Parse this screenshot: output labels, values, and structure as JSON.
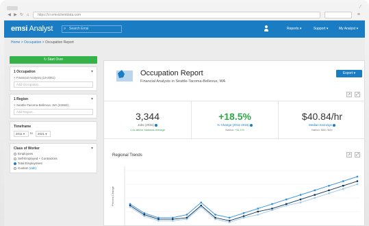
{
  "browser": {
    "url": "https://cr.emsiclientdata.com"
  },
  "app": {
    "logo_bold": "emsi",
    "logo_thin": " Analyst",
    "search_placeholder": "Search Emsi",
    "nav": [
      "Reports ▾",
      "Support ▾",
      "My Analyst ▾"
    ],
    "accent": "#1a7dc4"
  },
  "breadcrumb": {
    "home": "Home",
    "sep": " > ",
    "occupation": "Occupation",
    "current": "Occupation Report"
  },
  "sidebar": {
    "start_button": "↻ Start Over",
    "occupation": {
      "title": "1 Occupation",
      "value": "× Financial Analysts (13-2051)",
      "placeholder": "Add Occupation..."
    },
    "region": {
      "title": "1 Region",
      "value": "× Seattle-Tacoma-Bellevue, WA (42660)",
      "placeholder": "Add Region..."
    },
    "timeframe": {
      "title": "Timeframe",
      "from": "2011 ▾",
      "to_label": "to",
      "to": "2021 ▾"
    },
    "class_of_worker": {
      "title": "Class of Worker",
      "options": [
        "Employees",
        "Self-Employed + Contractors",
        "Total Employment",
        "Custom"
      ],
      "edit": "(edit)"
    }
  },
  "report": {
    "title": "Occupation Report",
    "subtitle": "Financial Analysts in Seattle-Tacoma-Bellevue, WA",
    "export": "Export ▾",
    "kpis": [
      {
        "value": "3,344",
        "label": "Jobs (2016)",
        "foot_a": "1.4x above National average",
        "foot_b": ""
      },
      {
        "value": "+18.5%",
        "label": "% Change (2011-2016)",
        "foot_a": "Nation: ",
        "foot_b": "+11.1%"
      },
      {
        "value": "$40.84/hr",
        "label": "Median Earnings",
        "foot_a": "Nation: $38.78/hr",
        "foot_b": ""
      }
    ],
    "chart_title": "Regional Trends",
    "ylabel": "Percent Change"
  },
  "chart_data": {
    "type": "line",
    "ylabel": "Percent Change",
    "series": [
      {
        "name": "",
        "color": "#2b8ee0",
        "values": [
          0,
          -6,
          -9,
          -9,
          -7,
          1,
          -7,
          -9,
          -6,
          -3,
          0,
          3,
          6,
          9,
          12,
          15,
          18
        ]
      },
      {
        "name": "",
        "color": "#0d2f55",
        "values": [
          -1,
          -7,
          -10,
          -10,
          -9,
          -1,
          -9,
          -11,
          -8,
          -5,
          -3,
          0,
          3,
          6,
          9,
          12,
          15
        ]
      },
      {
        "name": "",
        "color": "#9bc7ec",
        "values": [
          -2,
          -8,
          -11,
          -11,
          -10,
          -2,
          -10,
          -12,
          -9,
          -7,
          -4,
          -1,
          1,
          4,
          7,
          10,
          13
        ]
      }
    ],
    "ylim": [
      -14,
      22
    ]
  }
}
